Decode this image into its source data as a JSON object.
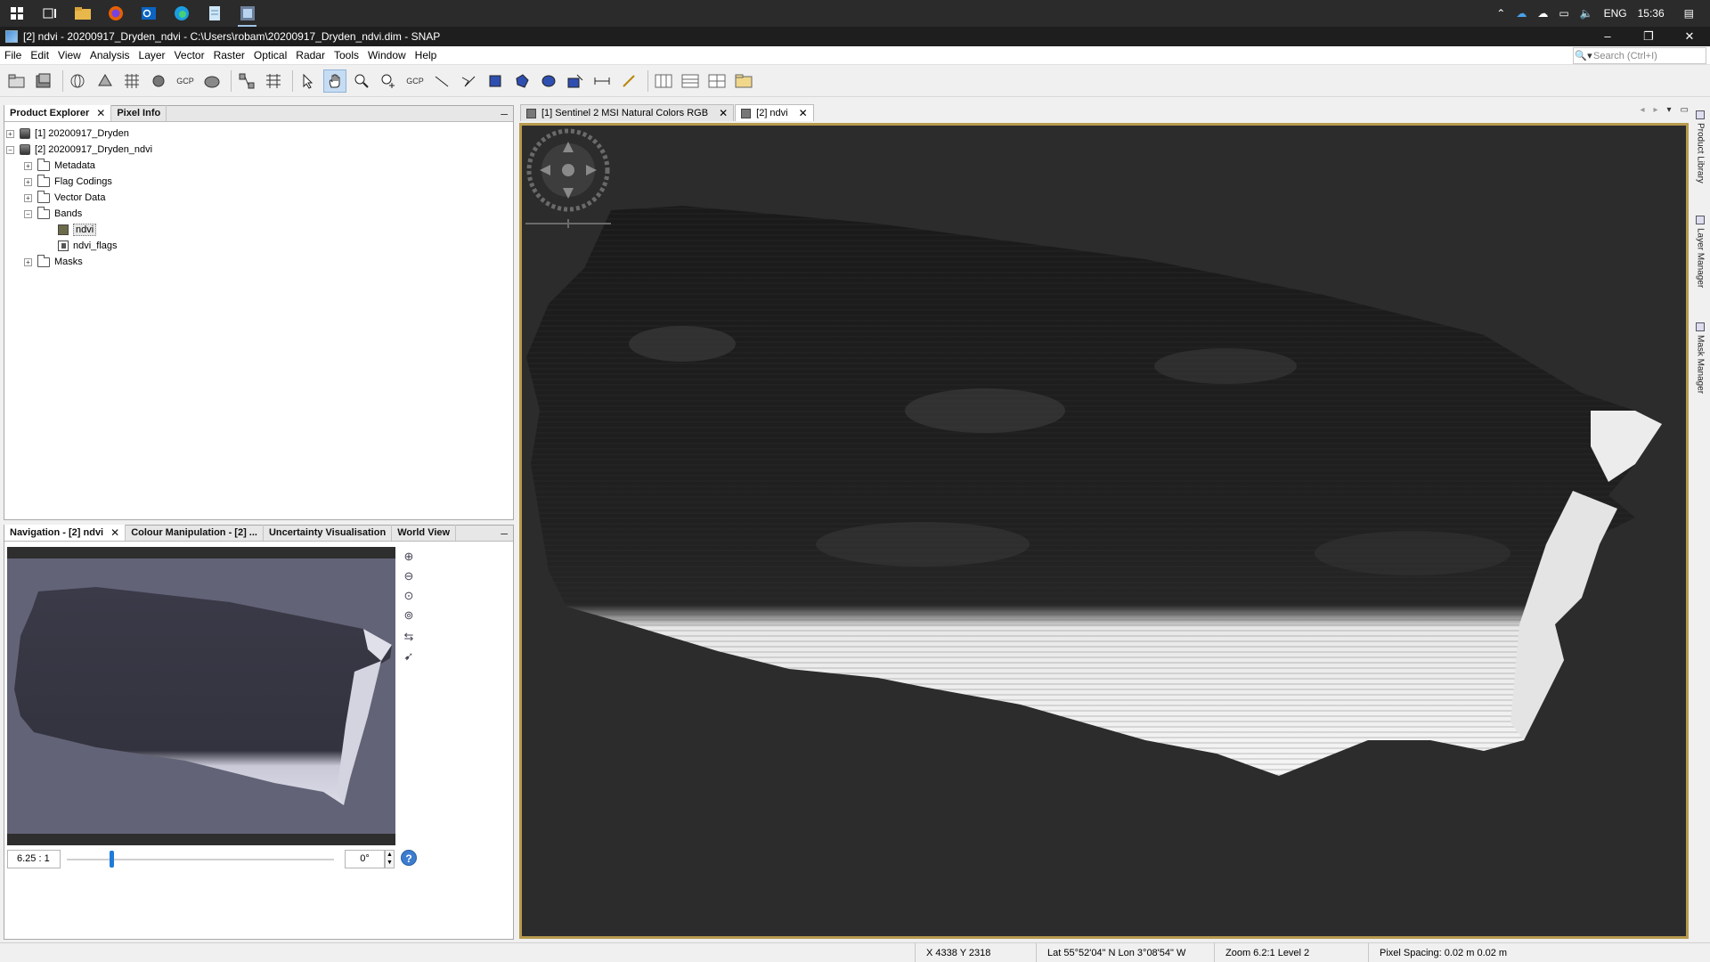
{
  "taskbar": {
    "tray": {
      "lang": "ENG",
      "time": "15:36"
    }
  },
  "window": {
    "title": "[2] ndvi - 20200917_Dryden_ndvi - C:\\Users\\robam\\20200917_Dryden_ndvi.dim - SNAP",
    "min": "–",
    "max": "❐",
    "close": "✕"
  },
  "menu": {
    "items": [
      "File",
      "Edit",
      "View",
      "Analysis",
      "Layer",
      "Vector",
      "Raster",
      "Optical",
      "Radar",
      "Tools",
      "Window",
      "Help"
    ],
    "search_placeholder": "Search (Ctrl+I)"
  },
  "toolbar": {
    "gcp1": "GCP",
    "gcp2": "GCP"
  },
  "explorer": {
    "tabs": [
      "Product Explorer",
      "Pixel Info"
    ],
    "tree": {
      "product1": "[1] 20200917_Dryden",
      "product2": "[2] 20200917_Dryden_ndvi",
      "metadata": "Metadata",
      "flag_codings": "Flag Codings",
      "vector_data": "Vector Data",
      "bands": "Bands",
      "band_ndvi": "ndvi",
      "band_flags": "ndvi_flags",
      "masks": "Masks"
    }
  },
  "nav_panel": {
    "tabs": [
      "Navigation - [2] ndvi",
      "Colour Manipulation - [2] ...",
      "Uncertainty Visualisation",
      "World View"
    ],
    "zoom_value": "6.25 : 1",
    "zoom_slider_fraction": 0.17,
    "angle_value": "0°",
    "help": "?"
  },
  "view": {
    "tabs": [
      "[1] Sentinel 2 MSI Natural Colors RGB",
      "[2] ndvi"
    ]
  },
  "right_panels": [
    "Product Library",
    "Layer Manager",
    "Mask Manager"
  ],
  "status": {
    "pixel": "X    4338   Y     2318",
    "latlon": "Lat 55°52'04\" N  Lon 3°08'54\" W",
    "zoom": "Zoom 6.2:1  Level 2",
    "spacing": "Pixel Spacing: 0.02 m 0.02 m"
  },
  "colors": {
    "view_border": "#b89a4e",
    "view_background": "#2c2c2c",
    "nav_background": "#636378"
  }
}
